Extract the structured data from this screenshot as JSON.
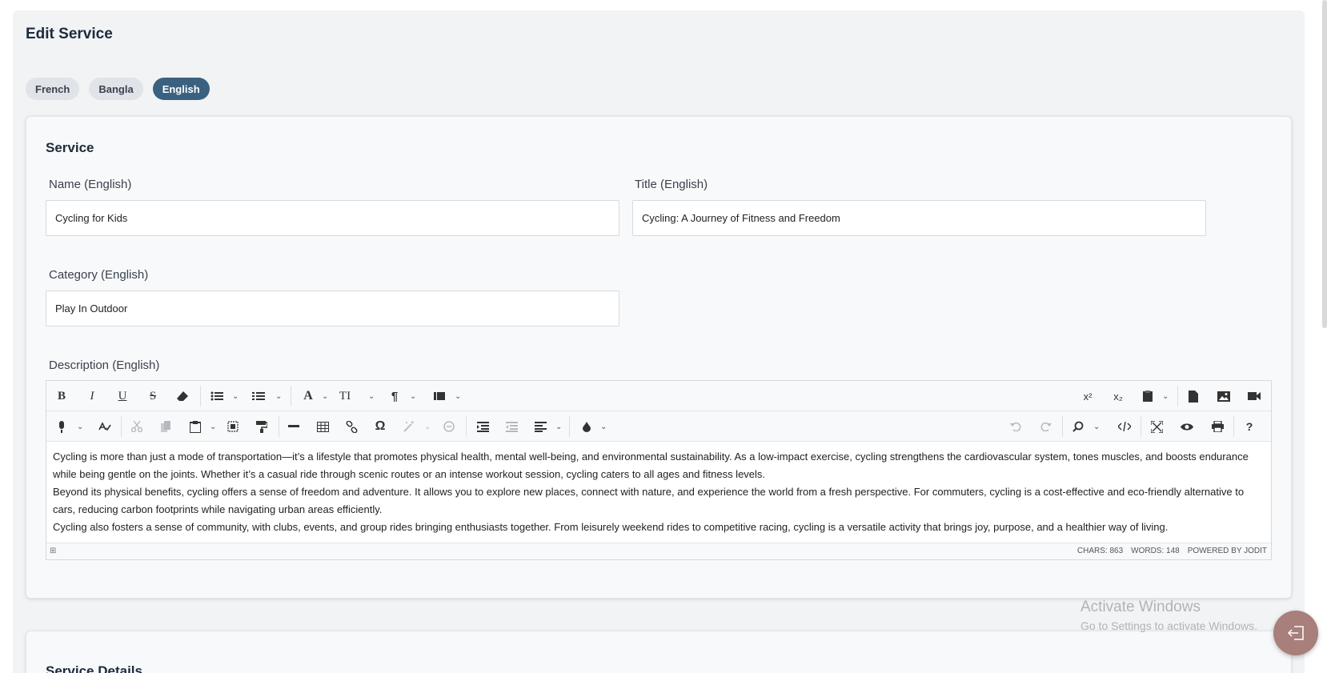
{
  "page": {
    "title": "Edit Service"
  },
  "languages": [
    {
      "label": "French",
      "active": false
    },
    {
      "label": "Bangla",
      "active": false
    },
    {
      "label": "English",
      "active": true
    }
  ],
  "service": {
    "section_title": "Service",
    "name": {
      "label": "Name (English)",
      "value": "Cycling for Kids"
    },
    "title": {
      "label": "Title (English)",
      "value": "Cycling: A Journey of Fitness and Freedom"
    },
    "category": {
      "label": "Category (English)",
      "value": "Play In Outdoor"
    },
    "description": {
      "label": "Description (English)",
      "paragraphs": [
        "Cycling is more than just a mode of transportation—it’s a lifestyle that promotes physical health, mental well-being, and environmental sustainability. As a low-impact exercise, cycling strengthens the cardiovascular system, tones muscles, and boosts endurance while being gentle on the joints. Whether it’s a casual ride through scenic routes or an intense workout session, cycling caters to all ages and fitness levels.",
        "Beyond its physical benefits, cycling offers a sense of freedom and adventure. It allows you to explore new places, connect with nature, and experience the world from a fresh perspective. For commuters, cycling is a cost-effective and eco-friendly alternative to cars, reducing carbon footprints while navigating urban areas efficiently.",
        "Cycling also fosters a sense of community, with clubs, events, and group rides bringing enthusiasts together. From leisurely weekend rides to competitive racing, cycling is a versatile activity that brings joy, purpose, and a healthier way of living."
      ],
      "status": {
        "chars": "CHARS: 863",
        "words": "WORDS: 148",
        "powered": "POWERED BY JODIT"
      }
    }
  },
  "details": {
    "section_title": "Service Details"
  },
  "watermark": {
    "line1": "Activate Windows",
    "line2": "Go to Settings to activate Windows."
  },
  "toolbar": {
    "bold": "B",
    "italic": "I",
    "underline": "U",
    "strike": "S",
    "font": "A",
    "font_size": "TI",
    "paragraph": "¶",
    "omega": "Ω",
    "help": "?",
    "superscript": "x²",
    "subscript": "x₂"
  },
  "colors": {
    "accent": "#3a6180",
    "fab": "#a87f7a",
    "panel": "#f1f3f5"
  }
}
